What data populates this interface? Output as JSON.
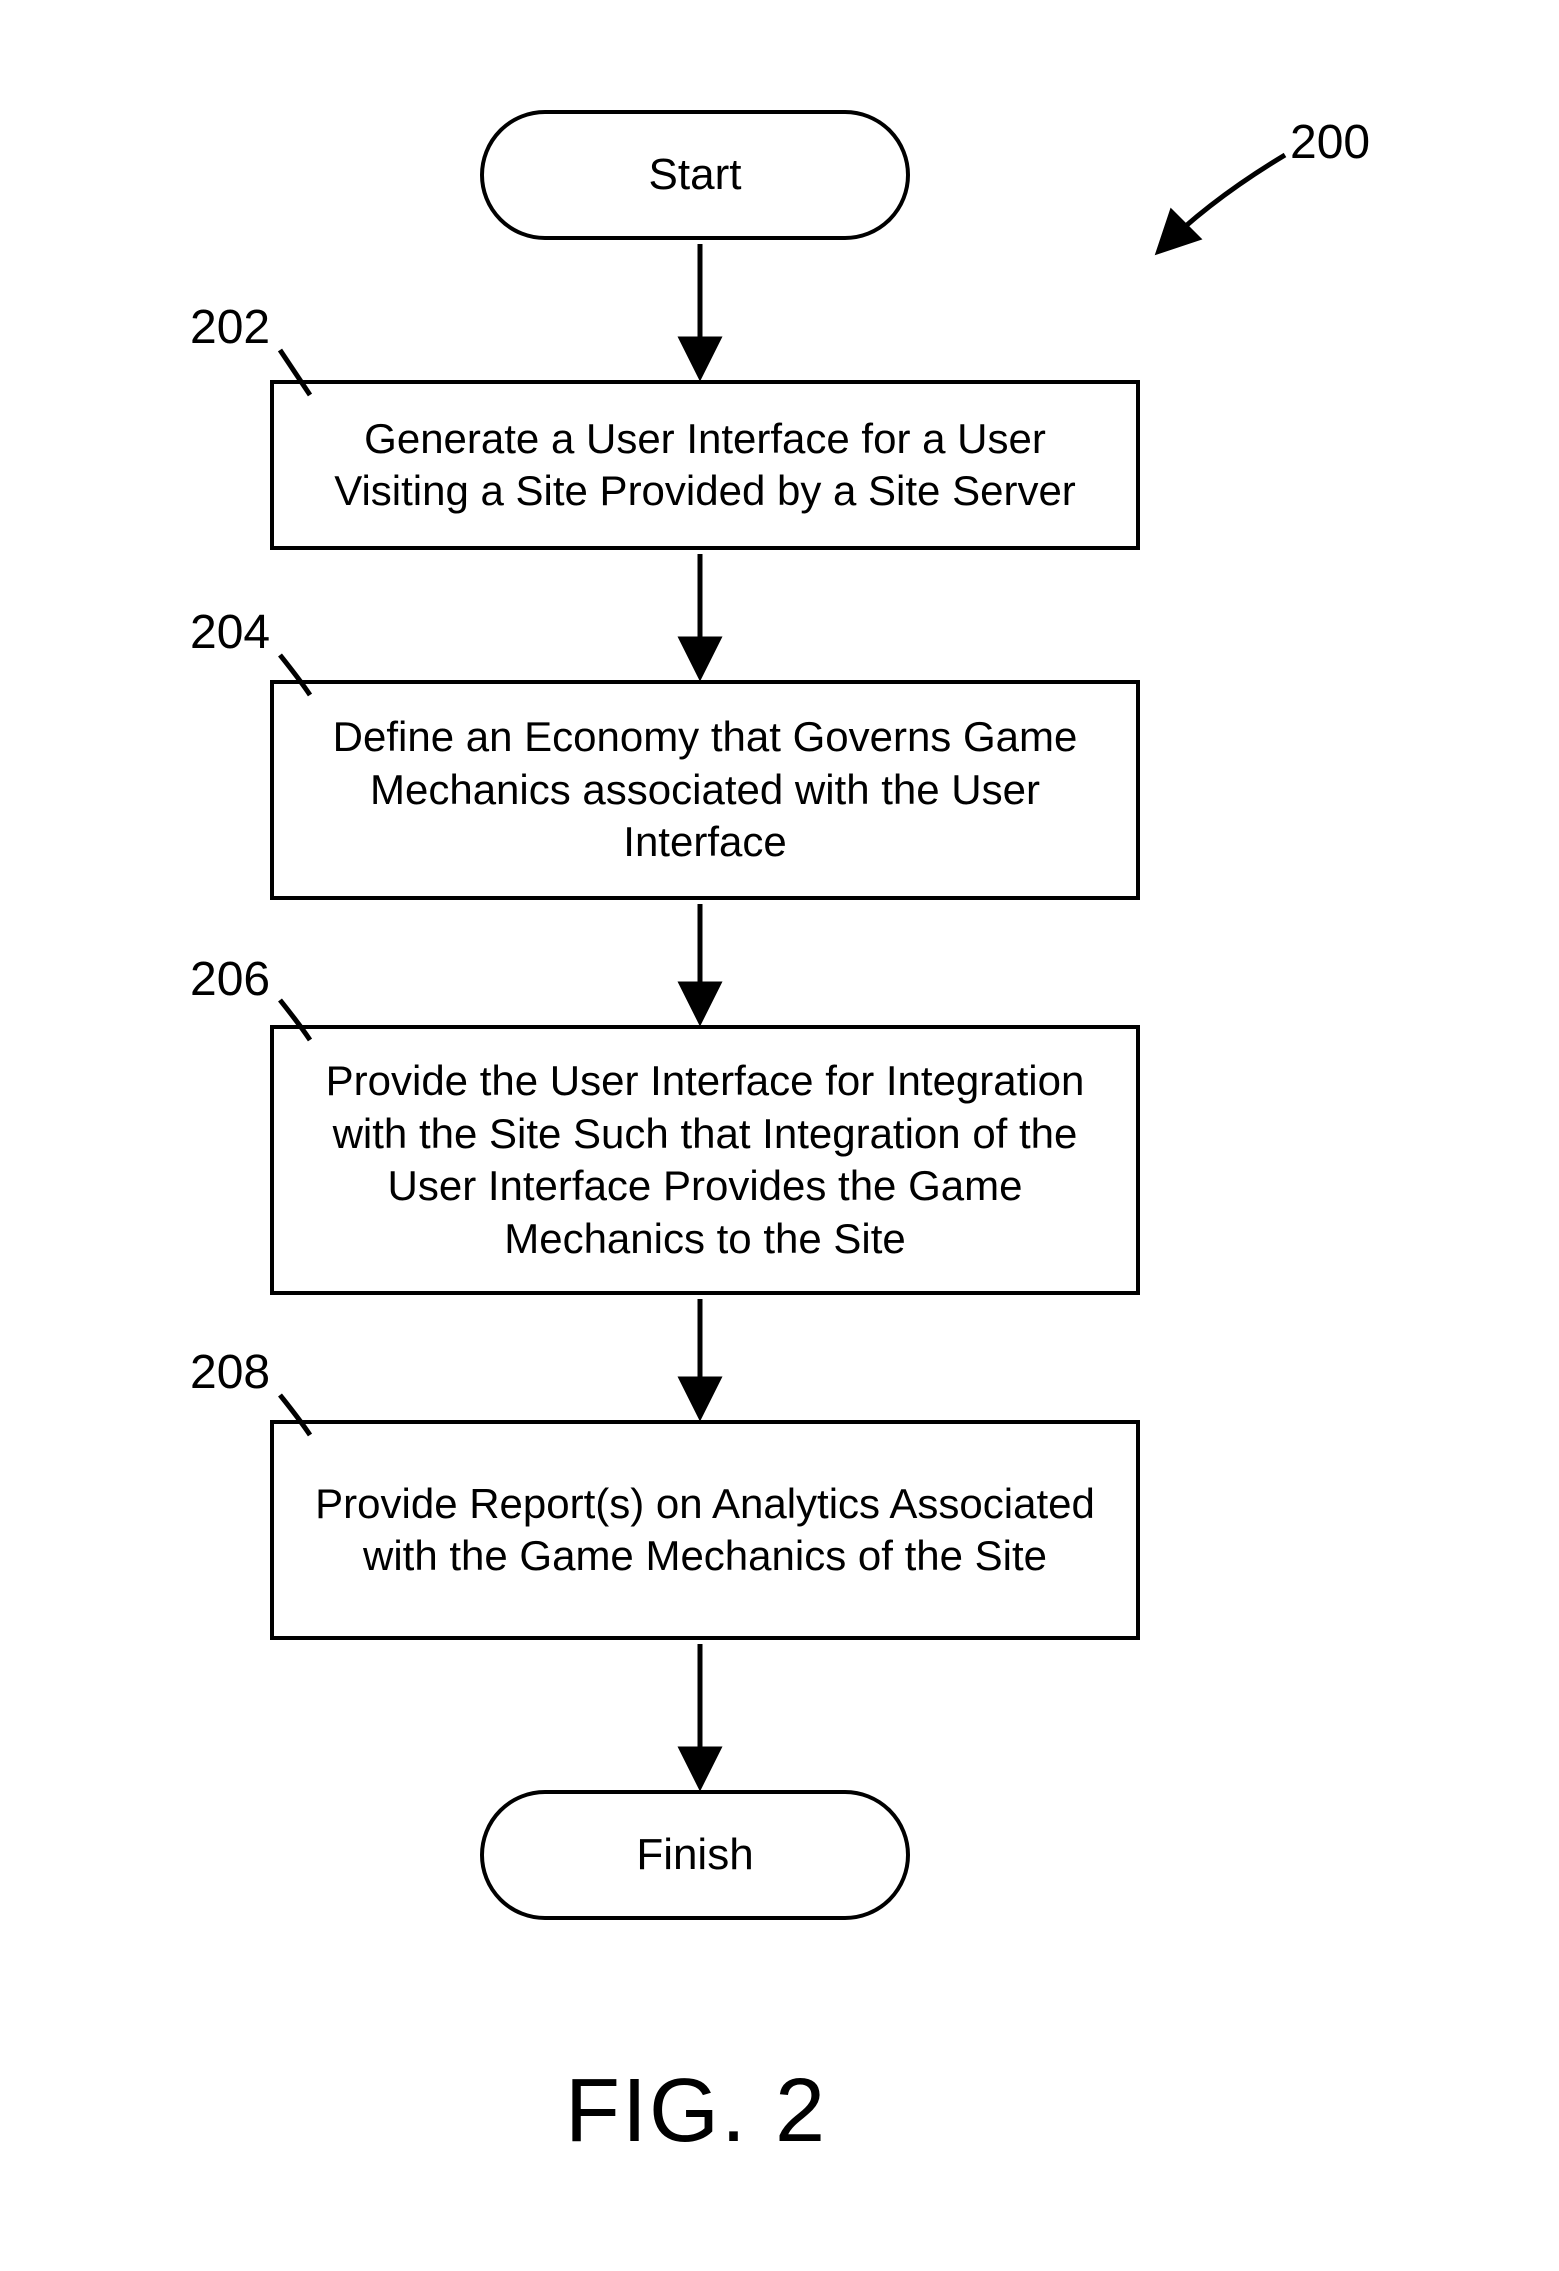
{
  "terminators": {
    "start": "Start",
    "finish": "Finish"
  },
  "steps": {
    "s202": "Generate a User Interface for a User Visiting a Site Provided by a Site Server",
    "s204": "Define an Economy that Governs Game Mechanics associated with the User Interface",
    "s206": "Provide the User Interface for Integration with the Site Such that Integration of the User Interface Provides the Game Mechanics to the Site",
    "s208": "Provide Report(s) on Analytics Associated with the Game Mechanics of the Site"
  },
  "refs": {
    "r200": "200",
    "r202": "202",
    "r204": "204",
    "r206": "206",
    "r208": "208"
  },
  "figure_label": "FIG. 2"
}
